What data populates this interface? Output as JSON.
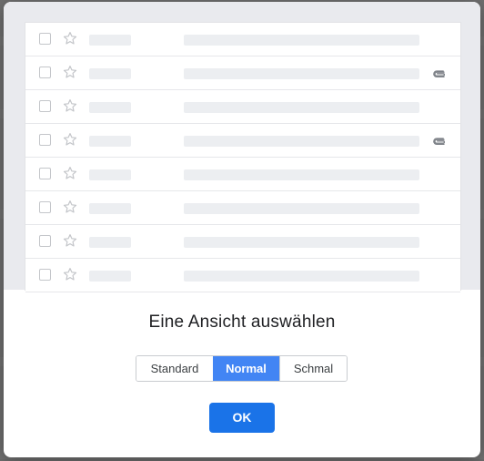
{
  "dialog": {
    "title": "Eine Ansicht auswählen",
    "options": [
      {
        "label": "Standard",
        "selected": false
      },
      {
        "label": "Normal",
        "selected": true
      },
      {
        "label": "Schmal",
        "selected": false
      }
    ],
    "ok_label": "OK"
  },
  "preview": {
    "rows": [
      {
        "attachment": false
      },
      {
        "attachment": true
      },
      {
        "attachment": false
      },
      {
        "attachment": true
      },
      {
        "attachment": false
      },
      {
        "attachment": false
      },
      {
        "attachment": false
      },
      {
        "attachment": false
      }
    ]
  },
  "colors": {
    "selected_option": "#4285f4",
    "ok_button": "#1a73e8",
    "overlay": "#6f6f6f",
    "preview_background": "#e9eaee"
  },
  "icons": {
    "checkbox": "checkbox-icon",
    "star": "star-icon",
    "attachment": "paperclip-icon"
  }
}
